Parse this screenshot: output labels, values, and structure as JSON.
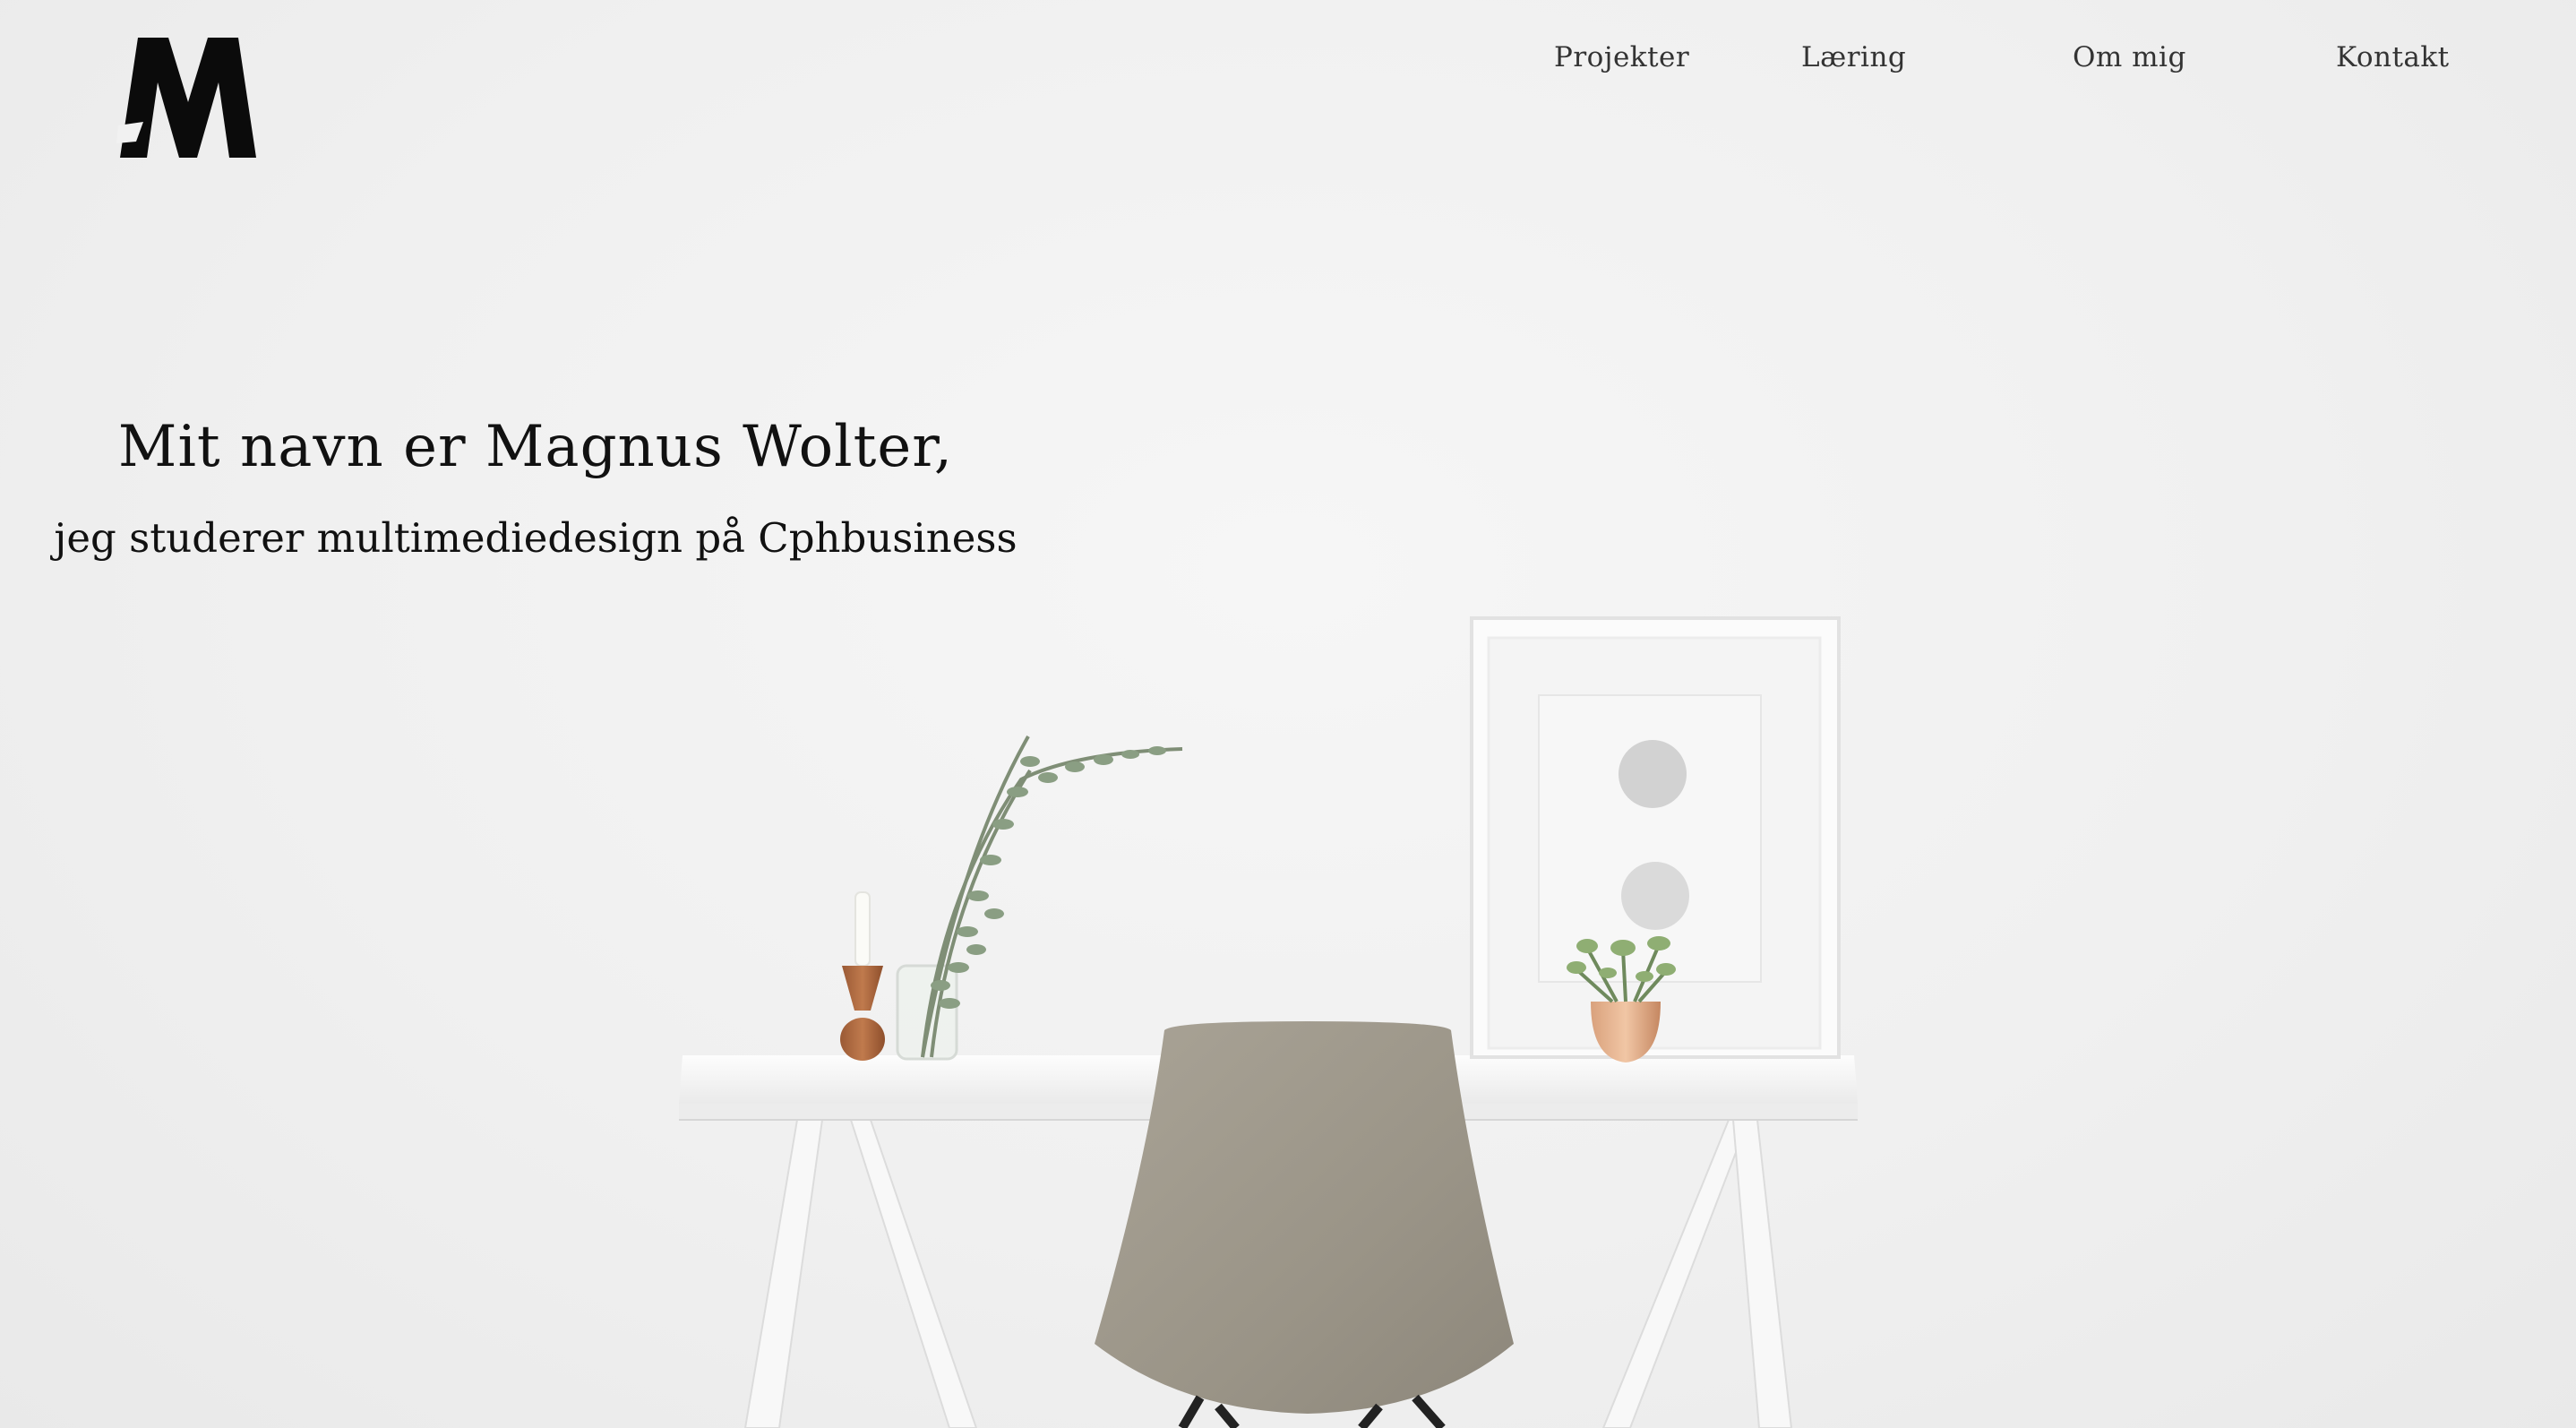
{
  "logo": {
    "alt": "M",
    "icon": "m-logo-icon"
  },
  "nav": {
    "items": [
      {
        "label": "Projekter"
      },
      {
        "label": "Læring"
      },
      {
        "label": "Om mig"
      },
      {
        "label": "Kontakt"
      }
    ]
  },
  "hero": {
    "headline": "Mit navn er Magnus Wolter,",
    "subheadline": "jeg studerer multimediedesign på Cphbusiness"
  },
  "colors": {
    "background": "#f1f1f1",
    "text": "#111111",
    "nav_text": "#333333",
    "chair": "#9d978a",
    "desk": "#fafafa"
  }
}
